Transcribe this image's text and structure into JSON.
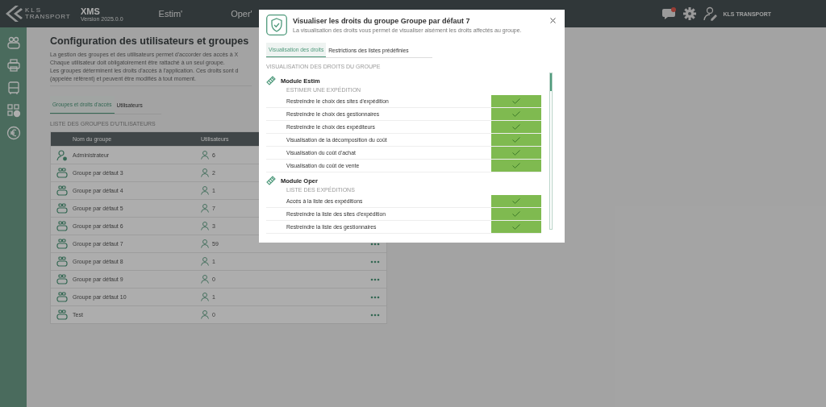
{
  "app": {
    "brand_top": "KLS",
    "brand_bottom": "TRANSPORT",
    "product": "XMS",
    "version": "Version 2025.0.0"
  },
  "nav": [
    {
      "label": "Estim'"
    },
    {
      "label": "Oper'"
    }
  ],
  "header_right": {
    "notification": true,
    "user": "KLS TRANSPORT"
  },
  "page": {
    "title": "Configuration des utilisateurs et groupes",
    "description": [
      "La gestion des groupes et des utilisateurs permet d'accorder des accès à X",
      "Chaque utilisateur doit obligatoirement être rattaché à un seul groupe.",
      "Les groupes déterminent les droits d'accès à l'application. Ces droits sont d",
      "(appelée référent) et peuvent être modifiés à tout moment."
    ],
    "tabs": [
      {
        "label": "Groupes et droits d'accès",
        "selected": true
      },
      {
        "label": "Utilisateurs",
        "selected": false
      }
    ],
    "section": "LISTE DES GROUPES D'UTILISATEURS",
    "table": {
      "columns": [
        "Nom du groupe",
        "Utilisateurs"
      ],
      "rows": [
        {
          "kind": "admin",
          "name": "Administrateur",
          "users": "6"
        },
        {
          "kind": "group",
          "name": "Groupe par défaut 3",
          "users": "2"
        },
        {
          "kind": "group",
          "name": "Groupe par défaut 4",
          "users": "1"
        },
        {
          "kind": "group",
          "name": "Groupe par défaut 5",
          "users": "7"
        },
        {
          "kind": "group",
          "name": "Groupe par défaut 6",
          "users": "3"
        },
        {
          "kind": "group",
          "name": "Groupe par défaut 7",
          "users": "59"
        },
        {
          "kind": "group",
          "name": "Groupe par défaut 8",
          "users": "1"
        },
        {
          "kind": "group",
          "name": "Groupe par défaut 9",
          "users": "0"
        },
        {
          "kind": "group",
          "name": "Groupe par défaut 10",
          "users": "1"
        },
        {
          "kind": "group",
          "name": "Test",
          "users": "0"
        }
      ]
    }
  },
  "modal": {
    "title": "Visualiser les droits du groupe Groupe par défaut 7",
    "subtitle": "La visualisation des droits vous permet de visualiser aisément les droits affectés au groupe.",
    "tabs": [
      {
        "label": "Visualisation des droits",
        "selected": true
      },
      {
        "label": "Restrictions des listes prédéfinies",
        "selected": false
      }
    ],
    "section": "VISUALISATION DES DROITS DU GROUPE",
    "modules": [
      {
        "title": "Module Estim",
        "group": "ESTIMER UNE EXPÉDITION",
        "rights": [
          {
            "label": "Restreindre le choix des sites d'expédition",
            "granted": true
          },
          {
            "label": "Restreindre le choix des gestionnaires",
            "granted": true
          },
          {
            "label": "Restreindre le choix des expéditeurs",
            "granted": true
          },
          {
            "label": "Visualisation de la décomposition du coût",
            "granted": true
          },
          {
            "label": "Visualisation du coût d'achat",
            "granted": true
          },
          {
            "label": "Visualisation du coût de vente",
            "granted": true
          }
        ]
      },
      {
        "title": "Module Oper",
        "group": "LISTE DES EXPÉDITIONS",
        "rights": [
          {
            "label": "Accès à la liste des expéditions",
            "granted": true
          },
          {
            "label": "Restreindre la liste des sites d'expédition",
            "granted": true
          },
          {
            "label": "Restreindre la liste des gestionnaires",
            "granted": true
          }
        ]
      }
    ]
  }
}
